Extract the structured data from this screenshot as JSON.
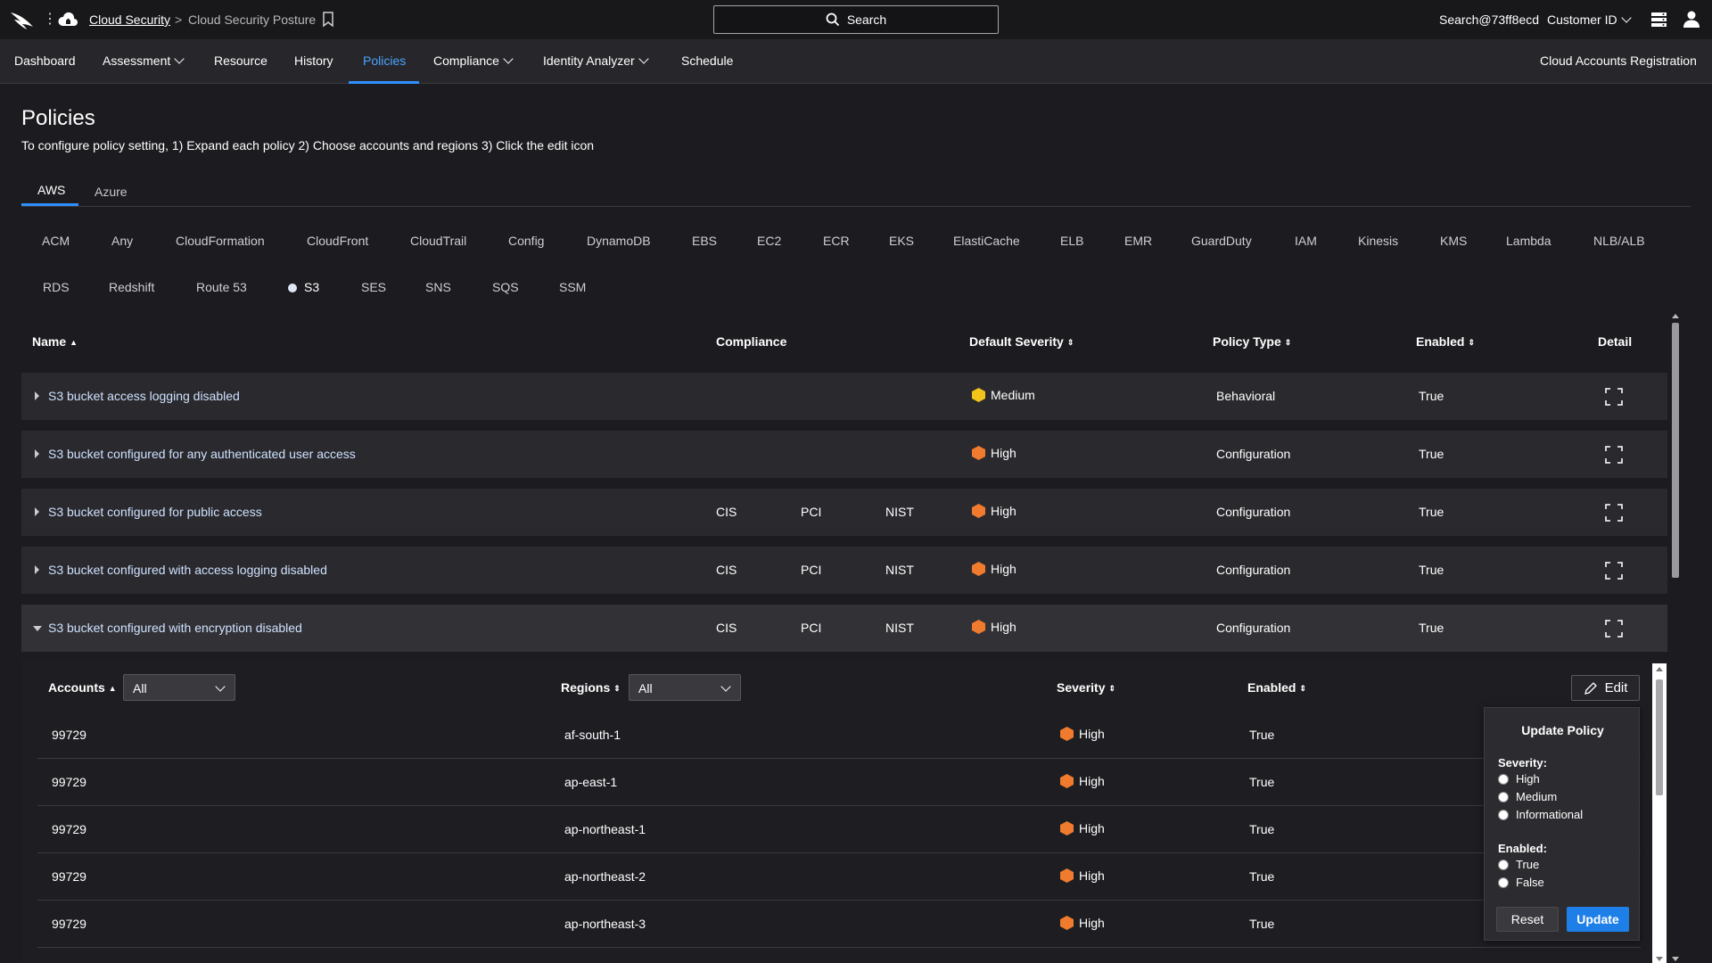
{
  "topbar": {
    "breadcrumb_link": "Cloud Security",
    "breadcrumb_sep": ">",
    "breadcrumb_current": "Cloud Security Posture",
    "search_label": "Search",
    "user": "Search@73ff8ecd",
    "customer_label": "Customer ID"
  },
  "nav": {
    "items": [
      "Dashboard",
      "Assessment",
      "Resource",
      "History",
      "Policies",
      "Compliance",
      "Identity Analyzer",
      "Schedule"
    ],
    "active": "Policies",
    "right_link": "Cloud Accounts Registration"
  },
  "page": {
    "title": "Policies",
    "description": "To configure policy setting, 1) Expand each policy 2) Choose accounts and regions 3) Click the edit icon"
  },
  "cloud_tabs": [
    "AWS",
    "Azure"
  ],
  "services": {
    "row1": [
      "ACM",
      "Any",
      "CloudFormation",
      "CloudFront",
      "CloudTrail",
      "Config",
      "DynamoDB",
      "EBS",
      "EC2",
      "ECR",
      "EKS",
      "ElastiCache",
      "ELB",
      "EMR",
      "GuardDuty",
      "IAM",
      "Kinesis",
      "KMS",
      "Lambda",
      "NLB/ALB"
    ],
    "row2": [
      "RDS",
      "Redshift",
      "Route 53",
      "S3",
      "SES",
      "SNS",
      "SQS",
      "SSM"
    ],
    "active": "S3"
  },
  "table": {
    "headers": [
      "Name",
      "Compliance",
      "Default Severity",
      "Policy Type",
      "Enabled",
      "Detail"
    ],
    "rows": [
      {
        "name": "S3 bucket access logging disabled",
        "compliance": [
          "",
          "",
          ""
        ],
        "severity": "Medium",
        "type": "Behavioral",
        "enabled": "True"
      },
      {
        "name": "S3 bucket configured for any authenticated user access",
        "compliance": [
          "",
          "",
          ""
        ],
        "severity": "High",
        "type": "Configuration",
        "enabled": "True"
      },
      {
        "name": "S3 bucket configured for public access",
        "compliance": [
          "CIS",
          "PCI",
          "NIST"
        ],
        "severity": "High",
        "type": "Configuration",
        "enabled": "True"
      },
      {
        "name": "S3 bucket configured with access logging disabled",
        "compliance": [
          "CIS",
          "PCI",
          "NIST"
        ],
        "severity": "High",
        "type": "Configuration",
        "enabled": "True"
      },
      {
        "name": "S3 bucket configured with encryption disabled",
        "compliance": [
          "CIS",
          "PCI",
          "NIST"
        ],
        "severity": "High",
        "type": "Configuration",
        "enabled": "True"
      }
    ]
  },
  "subtable": {
    "headers": {
      "accounts": "Accounts",
      "regions": "Regions",
      "severity": "Severity",
      "enabled": "Enabled"
    },
    "accounts_filter": "All",
    "regions_filter": "All",
    "edit_label": "Edit",
    "rows": [
      {
        "account": "99729",
        "region": "af-south-1",
        "severity": "High",
        "enabled": "True"
      },
      {
        "account": "99729",
        "region": "ap-east-1",
        "severity": "High",
        "enabled": "True"
      },
      {
        "account": "99729",
        "region": "ap-northeast-1",
        "severity": "High",
        "enabled": "True"
      },
      {
        "account": "99729",
        "region": "ap-northeast-2",
        "severity": "High",
        "enabled": "True"
      },
      {
        "account": "99729",
        "region": "ap-northeast-3",
        "severity": "High",
        "enabled": "True"
      }
    ]
  },
  "update_policy": {
    "title": "Update Policy",
    "severity_label": "Severity:",
    "severity_options": [
      "High",
      "Medium",
      "Informational"
    ],
    "enabled_label": "Enabled:",
    "enabled_options": [
      "True",
      "False"
    ],
    "reset": "Reset",
    "update": "Update"
  },
  "colors": {
    "accent": "#2f8fff",
    "high": "#f07a2e",
    "medium": "#f2c31b"
  }
}
